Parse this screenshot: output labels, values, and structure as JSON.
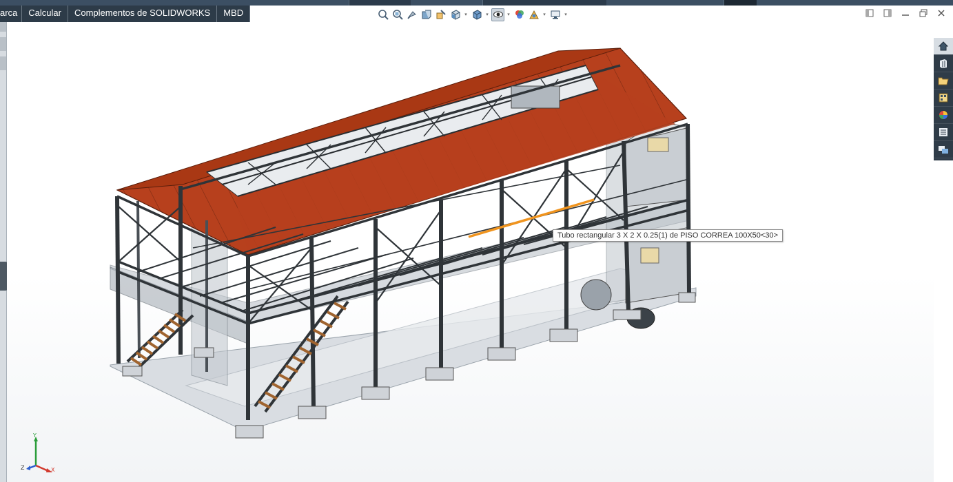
{
  "command_tabs": [
    "arca",
    "Calcular",
    "Complementos de SOLIDWORKS",
    "MBD"
  ],
  "heads_up_toolbar": [
    {
      "icon": "zoom-to-fit-icon"
    },
    {
      "icon": "zoom-to-area-icon"
    },
    {
      "icon": "previous-view-icon"
    },
    {
      "icon": "section-view-icon"
    },
    {
      "icon": "dynamic-annotation-views-icon"
    },
    {
      "icon": "view-orientation-icon",
      "dropdown": true
    },
    {
      "icon": "display-style-icon",
      "dropdown": true
    },
    {
      "icon": "hide-show-items-icon",
      "dropdown": true,
      "selected": true
    },
    {
      "icon": "edit-appearance-icon"
    },
    {
      "icon": "apply-scene-icon",
      "dropdown": true
    },
    {
      "icon": "view-settings-icon",
      "dropdown": true
    }
  ],
  "window_controls": [
    "restore-left-icon",
    "restore-right-icon",
    "minimize-icon",
    "maximize-icon",
    "close-icon"
  ],
  "task_pane": [
    {
      "icon": "solidworks-resources-icon",
      "active": true
    },
    {
      "icon": "design-library-icon"
    },
    {
      "icon": "file-explorer-icon"
    },
    {
      "icon": "view-palette-icon"
    },
    {
      "icon": "appearances-scenes-icon"
    },
    {
      "icon": "custom-properties-icon"
    },
    {
      "icon": "solidworks-forum-icon"
    }
  ],
  "tooltip_text": "Tubo rectangular 3 X 2 X 0.25(1) de PISO CORREA 100X50<30>",
  "triad": {
    "y": "Y",
    "z": "Z",
    "x": "X"
  },
  "colors": {
    "roof": "#b7401d",
    "steel": "#2f3438",
    "glass": "#b7bec6",
    "stairs": "#a0642f",
    "highlight": "#f0941e",
    "tab_bg": "#2d3b48"
  }
}
